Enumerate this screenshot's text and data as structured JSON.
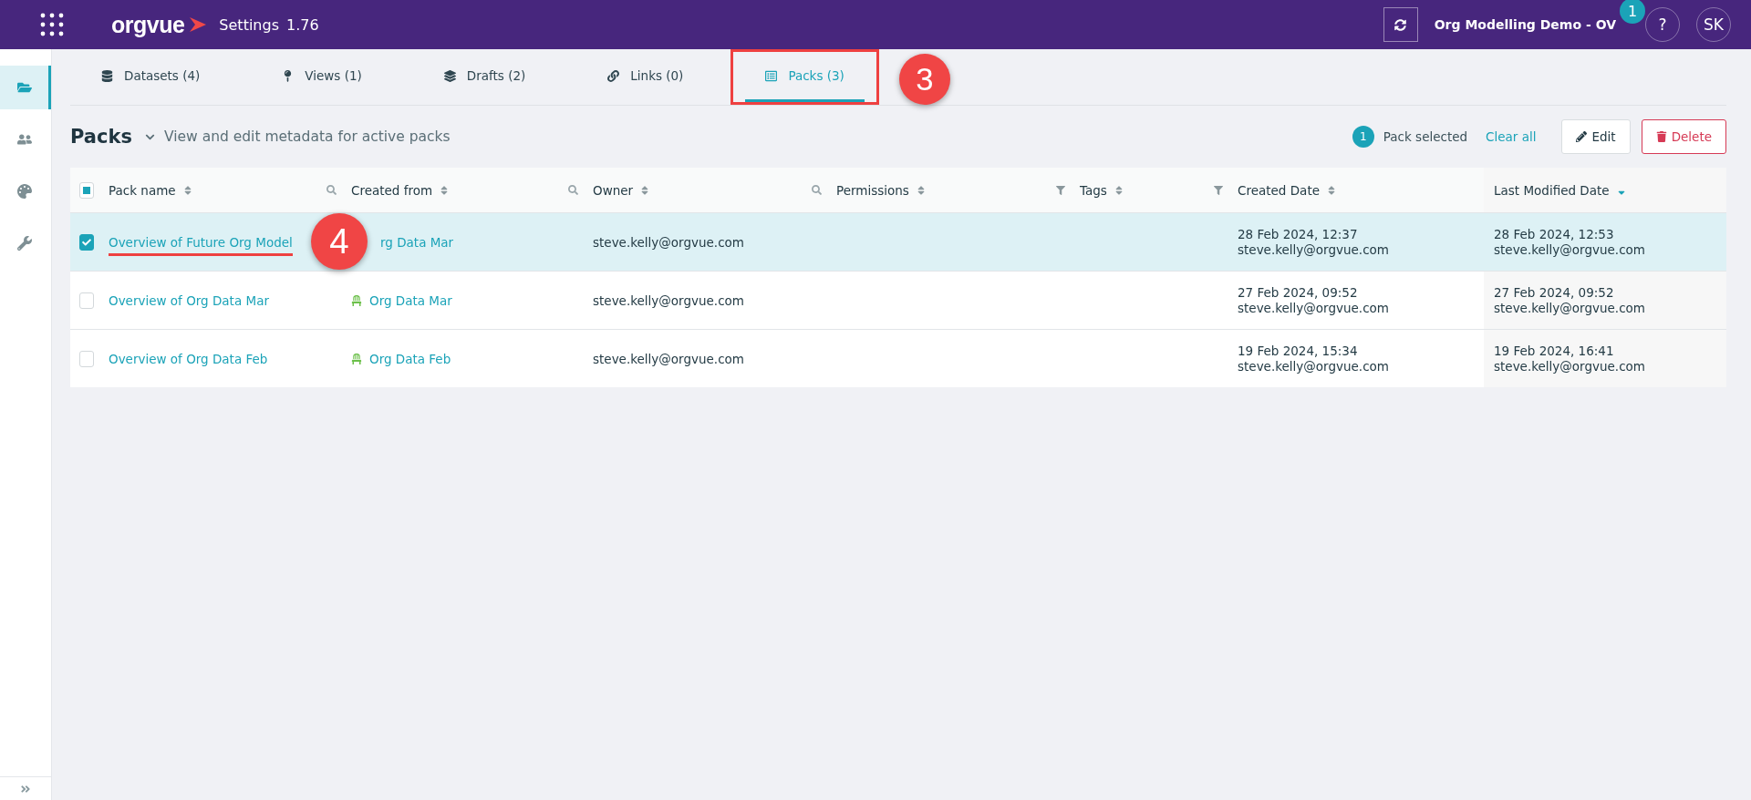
{
  "topbar": {
    "logo": "orgvue",
    "title": "Settings",
    "version": "1.76",
    "workspace": "Org Modelling Demo - OV",
    "help": "?",
    "notification_count": "1",
    "avatar": "SK"
  },
  "sidebar": {
    "items": [
      {
        "selected": true
      },
      {
        "selected": false
      },
      {
        "selected": false
      },
      {
        "selected": false
      }
    ]
  },
  "tabs": [
    {
      "label": "Datasets (4)",
      "selected": false,
      "highlighted": false
    },
    {
      "label": "Views (1)",
      "selected": false,
      "highlighted": false
    },
    {
      "label": "Drafts (2)",
      "selected": false,
      "highlighted": false
    },
    {
      "label": "Links (0)",
      "selected": false,
      "highlighted": false
    },
    {
      "label": "Packs (3)",
      "selected": true,
      "highlighted": true,
      "callout": "3"
    }
  ],
  "header": {
    "title": "Packs",
    "description": "View and edit metadata for active packs",
    "selected_count": "1",
    "selected_label": "Pack selected",
    "clear": "Clear all",
    "edit": "Edit",
    "delete": "Delete"
  },
  "table": {
    "select_all_partial": true,
    "columns": [
      {
        "label": "Pack name",
        "sorted": false,
        "search": true,
        "filter": false
      },
      {
        "label": "Created from",
        "sorted": false,
        "search": true,
        "filter": false
      },
      {
        "label": "Owner",
        "sorted": false,
        "search": true,
        "filter": false
      },
      {
        "label": "Permissions",
        "sorted": false,
        "search": false,
        "filter": true
      },
      {
        "label": "Tags",
        "sorted": false,
        "search": false,
        "filter": true
      },
      {
        "label": "Created Date",
        "sorted": false,
        "search": false,
        "filter": false
      },
      {
        "label": "Last Modified Date",
        "sorted": true,
        "search": false,
        "filter": false
      }
    ],
    "rows": [
      {
        "selected": true,
        "checked": true,
        "underlined": true,
        "callout": "4",
        "pack_name": "Overview of Future Org Model",
        "created_from": "rg Data Mar",
        "source_icon": false,
        "owner": "steve.kelly@orgvue.com",
        "created_date": "28 Feb 2024, 12:37",
        "created_by": "steve.kelly@orgvue.com",
        "modified_date": "28 Feb 2024, 12:53",
        "modified_by": "steve.kelly@orgvue.com"
      },
      {
        "selected": false,
        "checked": false,
        "underlined": false,
        "pack_name": "Overview of Org Data Mar",
        "created_from": "Org Data Mar",
        "source_icon": true,
        "owner": "steve.kelly@orgvue.com",
        "created_date": "27 Feb 2024, 09:52",
        "created_by": "steve.kelly@orgvue.com",
        "modified_date": "27 Feb 2024, 09:52",
        "modified_by": "steve.kelly@orgvue.com"
      },
      {
        "selected": false,
        "checked": false,
        "underlined": false,
        "pack_name": "Overview of Org Data Feb",
        "created_from": "Org Data Feb",
        "source_icon": true,
        "owner": "steve.kelly@orgvue.com",
        "created_date": "19 Feb 2024, 15:34",
        "created_by": "steve.kelly@orgvue.com",
        "modified_date": "19 Feb 2024, 16:41",
        "modified_by": "steve.kelly@orgvue.com"
      }
    ]
  }
}
